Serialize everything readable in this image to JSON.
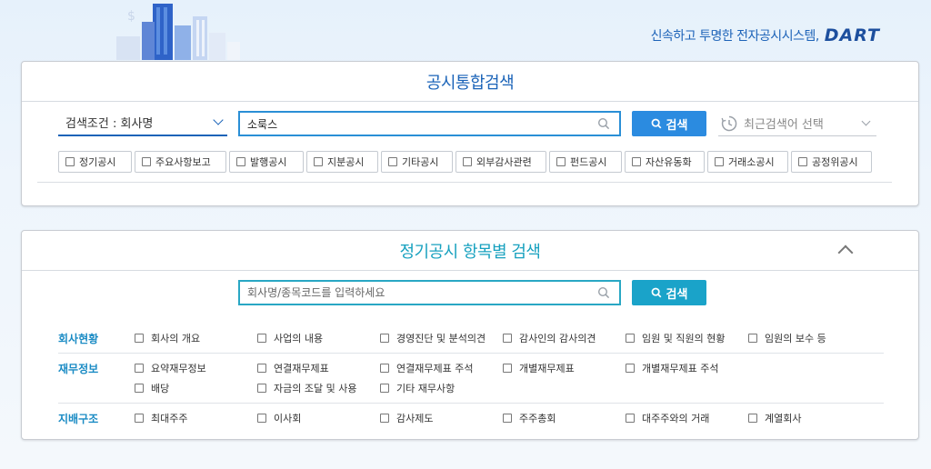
{
  "header": {
    "tagline": "신속하고 투명한 전자공시시스템,",
    "logo": "DART"
  },
  "integrated_search": {
    "title": "공시통합검색",
    "condition_label": "검색조건 : 회사명",
    "search_value": "소룩스",
    "search_button": "검색",
    "recent_label": "최근검색어 선택",
    "categories": [
      "정기공시",
      "주요사항보고",
      "발행공시",
      "지분공시",
      "기타공시",
      "외부감사관련",
      "펀드공시",
      "자산유동화",
      "거래소공시",
      "공정위공시"
    ]
  },
  "periodic_search": {
    "title": "정기공시 항목별 검색",
    "search_placeholder": "회사명/종목코드를 입력하세요",
    "search_button": "검색",
    "groups": [
      {
        "label": "회사현황",
        "items": [
          "회사의 개요",
          "사업의 내용",
          "경영진단 및 분석의견",
          "감사인의 감사의견",
          "임원 및 직원의 현황",
          "임원의 보수 등"
        ]
      },
      {
        "label": "재무정보",
        "items": [
          "요약재무정보",
          "연결재무제표",
          "연결재무제표 주석",
          "개별재무제표",
          "개별재무제표 주석",
          "배당",
          "자금의 조달 및 사용",
          "기타 재무사항"
        ]
      },
      {
        "label": "지배구조",
        "items": [
          "최대주주",
          "이사회",
          "감사제도",
          "주주총회",
          "대주주와의 거래",
          "계열회사"
        ]
      }
    ]
  },
  "colors": {
    "primary": "#1a63b8",
    "accent": "#17a1bf",
    "button": "#2b8be0"
  }
}
